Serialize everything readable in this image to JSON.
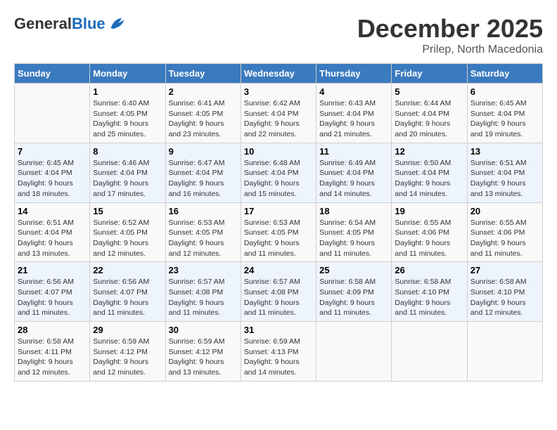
{
  "header": {
    "logo_general": "General",
    "logo_blue": "Blue",
    "month_title": "December 2025",
    "location": "Prilep, North Macedonia"
  },
  "days_of_week": [
    "Sunday",
    "Monday",
    "Tuesday",
    "Wednesday",
    "Thursday",
    "Friday",
    "Saturday"
  ],
  "weeks": [
    [
      {
        "day": "",
        "info": ""
      },
      {
        "day": "1",
        "info": "Sunrise: 6:40 AM\nSunset: 4:05 PM\nDaylight: 9 hours\nand 25 minutes."
      },
      {
        "day": "2",
        "info": "Sunrise: 6:41 AM\nSunset: 4:05 PM\nDaylight: 9 hours\nand 23 minutes."
      },
      {
        "day": "3",
        "info": "Sunrise: 6:42 AM\nSunset: 4:04 PM\nDaylight: 9 hours\nand 22 minutes."
      },
      {
        "day": "4",
        "info": "Sunrise: 6:43 AM\nSunset: 4:04 PM\nDaylight: 9 hours\nand 21 minutes."
      },
      {
        "day": "5",
        "info": "Sunrise: 6:44 AM\nSunset: 4:04 PM\nDaylight: 9 hours\nand 20 minutes."
      },
      {
        "day": "6",
        "info": "Sunrise: 6:45 AM\nSunset: 4:04 PM\nDaylight: 9 hours\nand 19 minutes."
      }
    ],
    [
      {
        "day": "7",
        "info": "Sunrise: 6:45 AM\nSunset: 4:04 PM\nDaylight: 9 hours\nand 18 minutes."
      },
      {
        "day": "8",
        "info": "Sunrise: 6:46 AM\nSunset: 4:04 PM\nDaylight: 9 hours\nand 17 minutes."
      },
      {
        "day": "9",
        "info": "Sunrise: 6:47 AM\nSunset: 4:04 PM\nDaylight: 9 hours\nand 16 minutes."
      },
      {
        "day": "10",
        "info": "Sunrise: 6:48 AM\nSunset: 4:04 PM\nDaylight: 9 hours\nand 15 minutes."
      },
      {
        "day": "11",
        "info": "Sunrise: 6:49 AM\nSunset: 4:04 PM\nDaylight: 9 hours\nand 14 minutes."
      },
      {
        "day": "12",
        "info": "Sunrise: 6:50 AM\nSunset: 4:04 PM\nDaylight: 9 hours\nand 14 minutes."
      },
      {
        "day": "13",
        "info": "Sunrise: 6:51 AM\nSunset: 4:04 PM\nDaylight: 9 hours\nand 13 minutes."
      }
    ],
    [
      {
        "day": "14",
        "info": "Sunrise: 6:51 AM\nSunset: 4:04 PM\nDaylight: 9 hours\nand 13 minutes."
      },
      {
        "day": "15",
        "info": "Sunrise: 6:52 AM\nSunset: 4:05 PM\nDaylight: 9 hours\nand 12 minutes."
      },
      {
        "day": "16",
        "info": "Sunrise: 6:53 AM\nSunset: 4:05 PM\nDaylight: 9 hours\nand 12 minutes."
      },
      {
        "day": "17",
        "info": "Sunrise: 6:53 AM\nSunset: 4:05 PM\nDaylight: 9 hours\nand 11 minutes."
      },
      {
        "day": "18",
        "info": "Sunrise: 6:54 AM\nSunset: 4:05 PM\nDaylight: 9 hours\nand 11 minutes."
      },
      {
        "day": "19",
        "info": "Sunrise: 6:55 AM\nSunset: 4:06 PM\nDaylight: 9 hours\nand 11 minutes."
      },
      {
        "day": "20",
        "info": "Sunrise: 6:55 AM\nSunset: 4:06 PM\nDaylight: 9 hours\nand 11 minutes."
      }
    ],
    [
      {
        "day": "21",
        "info": "Sunrise: 6:56 AM\nSunset: 4:07 PM\nDaylight: 9 hours\nand 11 minutes."
      },
      {
        "day": "22",
        "info": "Sunrise: 6:56 AM\nSunset: 4:07 PM\nDaylight: 9 hours\nand 11 minutes."
      },
      {
        "day": "23",
        "info": "Sunrise: 6:57 AM\nSunset: 4:08 PM\nDaylight: 9 hours\nand 11 minutes."
      },
      {
        "day": "24",
        "info": "Sunrise: 6:57 AM\nSunset: 4:08 PM\nDaylight: 9 hours\nand 11 minutes."
      },
      {
        "day": "25",
        "info": "Sunrise: 6:58 AM\nSunset: 4:09 PM\nDaylight: 9 hours\nand 11 minutes."
      },
      {
        "day": "26",
        "info": "Sunrise: 6:58 AM\nSunset: 4:10 PM\nDaylight: 9 hours\nand 11 minutes."
      },
      {
        "day": "27",
        "info": "Sunrise: 6:58 AM\nSunset: 4:10 PM\nDaylight: 9 hours\nand 12 minutes."
      }
    ],
    [
      {
        "day": "28",
        "info": "Sunrise: 6:58 AM\nSunset: 4:11 PM\nDaylight: 9 hours\nand 12 minutes."
      },
      {
        "day": "29",
        "info": "Sunrise: 6:59 AM\nSunset: 4:12 PM\nDaylight: 9 hours\nand 12 minutes."
      },
      {
        "day": "30",
        "info": "Sunrise: 6:59 AM\nSunset: 4:12 PM\nDaylight: 9 hours\nand 13 minutes."
      },
      {
        "day": "31",
        "info": "Sunrise: 6:59 AM\nSunset: 4:13 PM\nDaylight: 9 hours\nand 14 minutes."
      },
      {
        "day": "",
        "info": ""
      },
      {
        "day": "",
        "info": ""
      },
      {
        "day": "",
        "info": ""
      }
    ]
  ]
}
